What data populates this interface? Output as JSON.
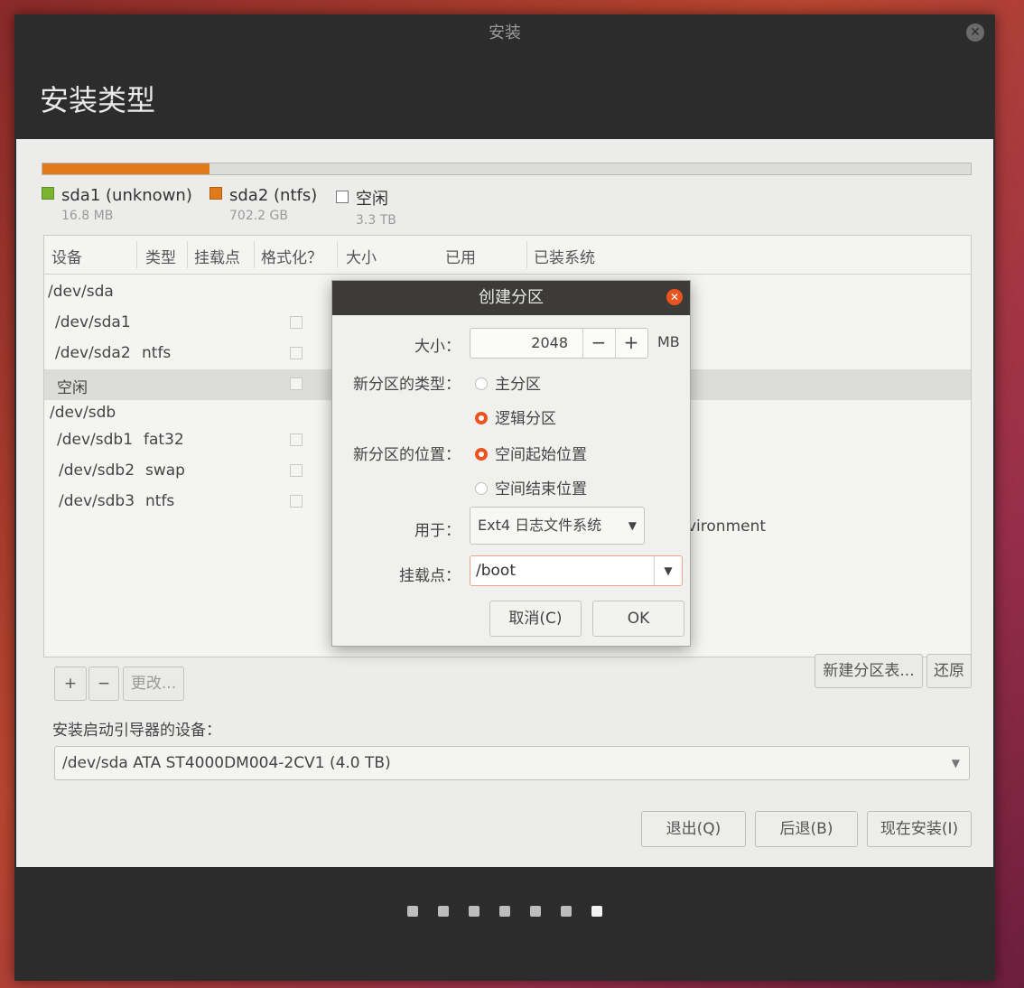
{
  "window": {
    "title": "安装",
    "heading": "安装类型"
  },
  "partition_bar": {
    "fill_fraction": 0.18,
    "fill_color": "#e07a1a",
    "legend": [
      {
        "name": "sda1 (unknown)",
        "size": "16.8 MB",
        "color": "#7ab32e"
      },
      {
        "name": "sda2 (ntfs)",
        "size": "702.2 GB",
        "color": "#e07a1a"
      },
      {
        "name": "空闲",
        "size": "3.3 TB",
        "color": "#ffffff"
      }
    ]
  },
  "table": {
    "headers": [
      "设备",
      "类型",
      "挂载点",
      "格式化？",
      "大小",
      "已用",
      "已装系统"
    ],
    "rows": [
      {
        "device": "/dev/sda",
        "type": ""
      },
      {
        "device": "/dev/sda1",
        "type": ""
      },
      {
        "device": "/dev/sda2",
        "type": "ntfs"
      },
      {
        "device": "空闲",
        "type": ""
      },
      {
        "device": "/dev/sdb",
        "type": ""
      },
      {
        "device": "/dev/sdb1",
        "type": "fat32"
      },
      {
        "device": "/dev/sdb2",
        "type": "swap"
      },
      {
        "device": "/dev/sdb3",
        "type": "ntfs"
      }
    ],
    "partial_text": "vironment"
  },
  "table_buttons": {
    "add": "+",
    "remove": "−",
    "change": "更改...",
    "new_table": "新建分区表...",
    "revert": "还原"
  },
  "bootloader": {
    "label": "安装启动引导器的设备：",
    "value": "/dev/sda   ATA ST4000DM004-2CV1 (4.0 TB)"
  },
  "actions": {
    "quit": "退出(Q)",
    "back": "后退(B)",
    "install": "现在安装(I)"
  },
  "progress": {
    "total": 7,
    "current": 7
  },
  "dialog": {
    "title": "创建分区",
    "size_label": "大小：",
    "size_value": "2048",
    "minus": "−",
    "plus": "+",
    "unit": "MB",
    "type_label": "新分区的类型：",
    "type_options": [
      "主分区",
      "逻辑分区"
    ],
    "type_selected": 1,
    "location_label": "新分区的位置：",
    "location_options": [
      "空间起始位置",
      "空间结束位置"
    ],
    "location_selected": 0,
    "use_label": "用于：",
    "use_value": "Ext4 日志文件系统",
    "mount_label": "挂载点：",
    "mount_value": "/boot",
    "cancel": "取消(C)",
    "ok": "OK"
  }
}
